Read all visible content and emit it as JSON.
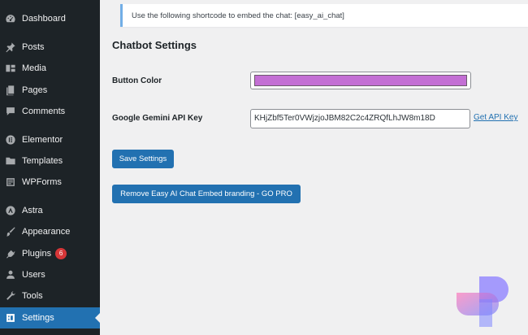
{
  "sidebar": {
    "items": [
      {
        "label": "Dashboard",
        "icon": "dashboard-icon"
      },
      {
        "label": "Posts",
        "icon": "pushpin-icon"
      },
      {
        "label": "Media",
        "icon": "media-icon"
      },
      {
        "label": "Pages",
        "icon": "pages-icon"
      },
      {
        "label": "Comments",
        "icon": "comment-icon"
      },
      {
        "label": "Elementor",
        "icon": "elementor-icon"
      },
      {
        "label": "Templates",
        "icon": "folder-icon"
      },
      {
        "label": "WPForms",
        "icon": "forms-icon"
      },
      {
        "label": "Astra",
        "icon": "astra-icon"
      },
      {
        "label": "Appearance",
        "icon": "paintbrush-icon"
      },
      {
        "label": "Plugins",
        "icon": "plug-icon",
        "badge": "6"
      },
      {
        "label": "Users",
        "icon": "user-icon"
      },
      {
        "label": "Tools",
        "icon": "wrench-icon"
      },
      {
        "label": "Settings",
        "icon": "settings-icon",
        "active": true
      }
    ]
  },
  "notice": {
    "text": "Use the following shortcode to embed the chat: [easy_ai_chat]"
  },
  "main": {
    "title": "Chatbot Settings",
    "button_color_label": "Button Color",
    "button_color_value": "#c36fd4",
    "api_key_label": "Google Gemini API Key",
    "api_key_value": "KHjZbf5Ter0VWjzjoJBM82C2c4ZRQfLhJW8m18D",
    "get_api_key_link": "Get API Key",
    "save_button": "Save Settings",
    "pro_button": "Remove Easy AI Chat Embed branding - GO PRO"
  },
  "colors": {
    "sidebar_bg": "#1d2327",
    "accent": "#2271b1",
    "badge": "#d63638"
  }
}
